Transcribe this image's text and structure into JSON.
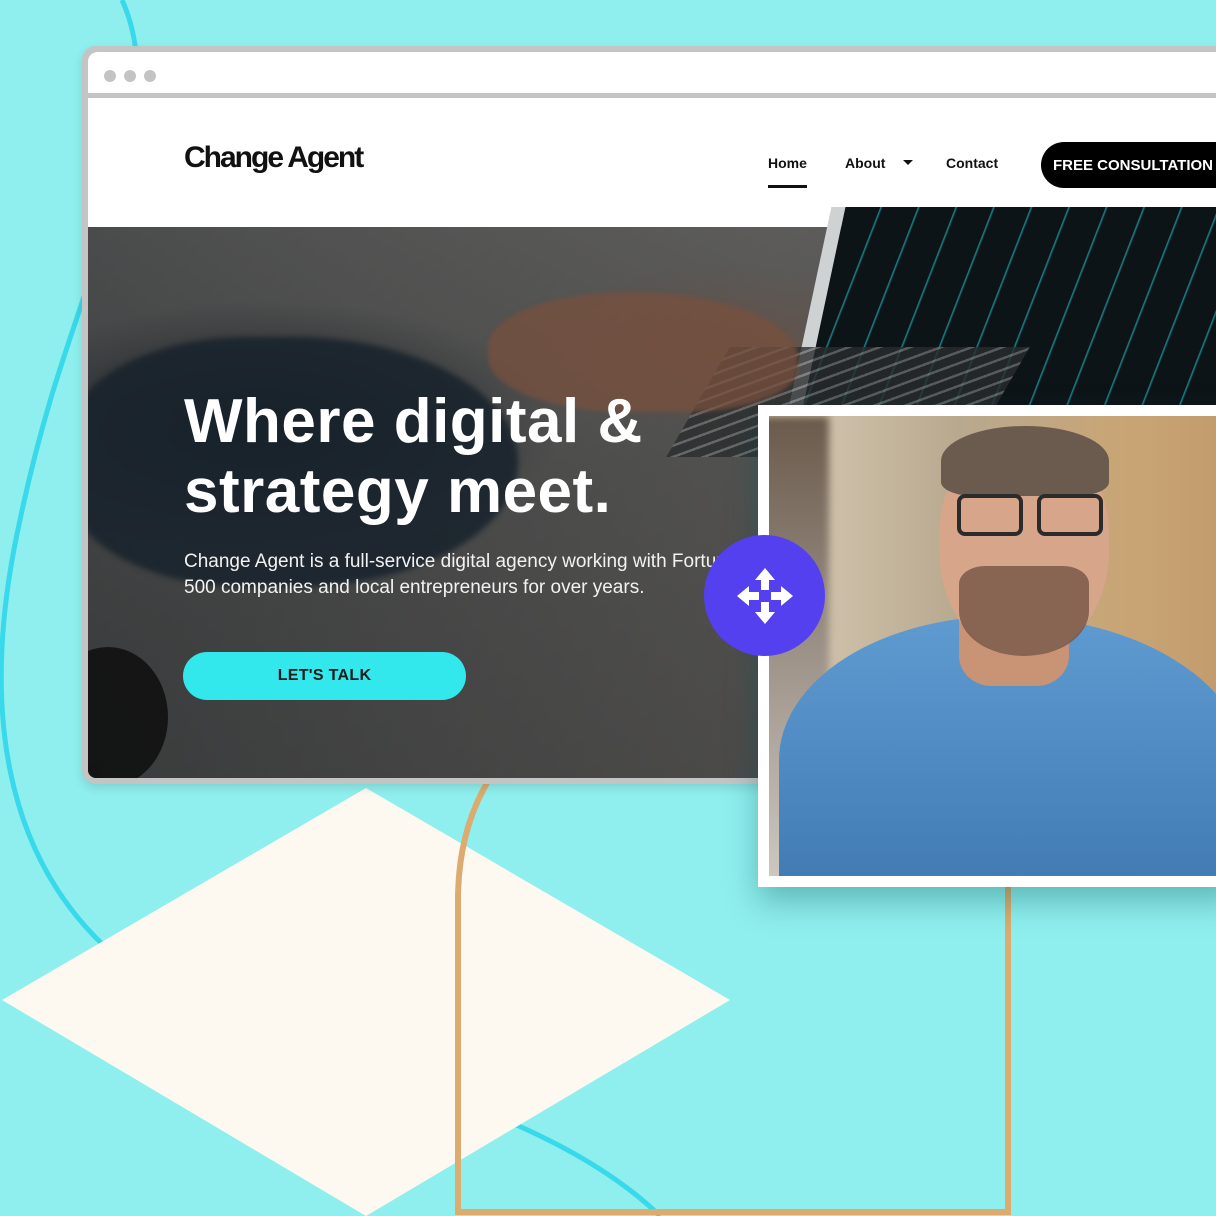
{
  "colors": {
    "background": "#8fefee",
    "accent_cyan": "#33e8ec",
    "move_handle": "#5540f0",
    "arch": "#dcab6f",
    "diamond": "#fdf9f1",
    "curve": "#38d9ea"
  },
  "browser": {
    "window_controls": [
      "dot",
      "dot",
      "dot"
    ]
  },
  "site": {
    "logo": "Change Agent",
    "nav": {
      "home": "Home",
      "about": "About",
      "contact": "Contact",
      "active": "Home"
    },
    "cta_label": "FREE CONSULTATION",
    "hero": {
      "headline_line1": "Where digital &",
      "headline_line2": "strategy meet.",
      "subtext": "Change Agent is a full-service digital agency working with Fortune 500 companies and local entrepreneurs for over years.",
      "button_label": "LET'S TALK"
    }
  },
  "overlay": {
    "photo_alt": "man-with-glasses-in-denim-shirt",
    "move_icon": "move-arrows-icon"
  }
}
